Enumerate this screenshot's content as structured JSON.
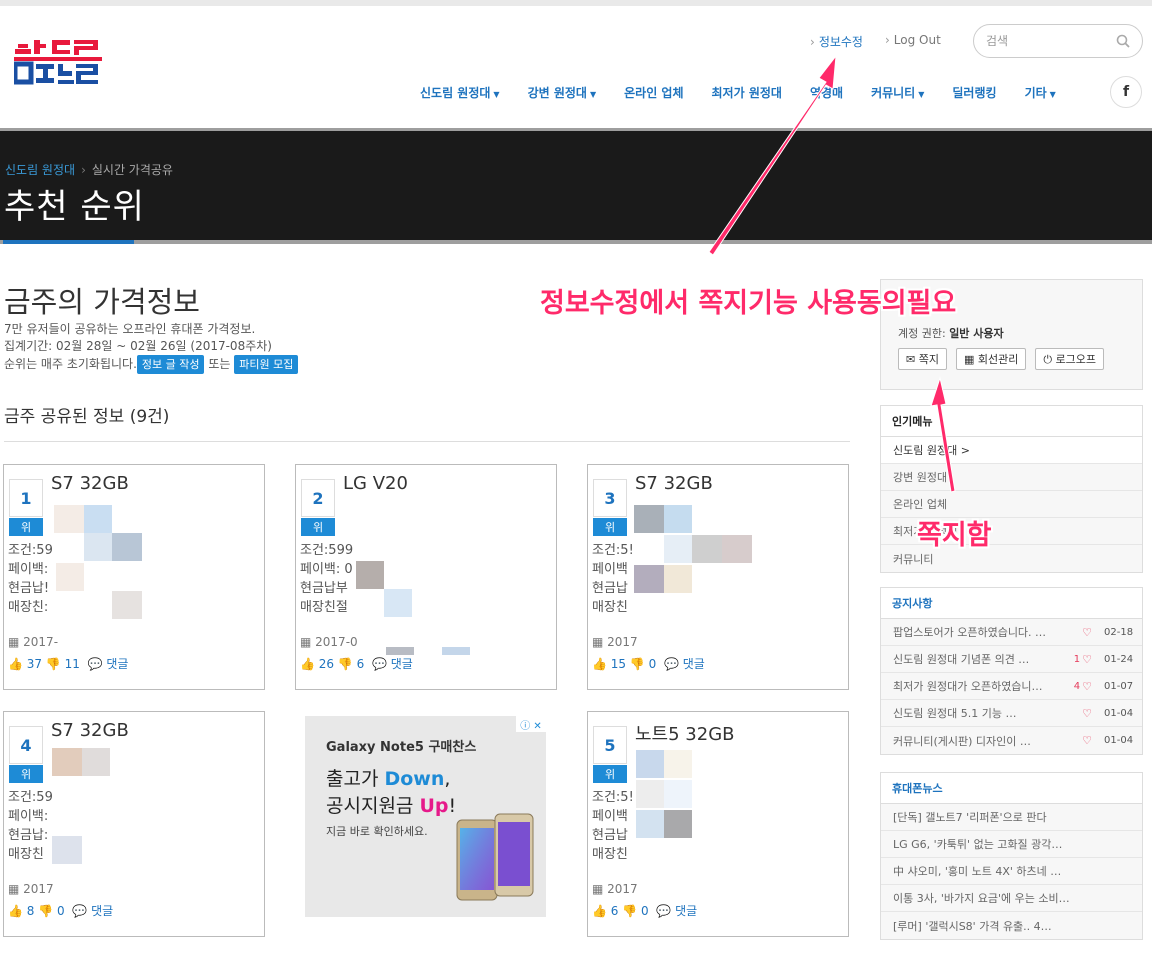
{
  "header": {
    "logo_text": "송도르",
    "toplinks": {
      "edit_info": "정보수정",
      "logout": "Log Out"
    },
    "search": {
      "placeholder": "검색"
    },
    "nav": [
      "신도림 원정대",
      "강변 원정대",
      "온라인 업체",
      "최저가 원정대",
      "역경매",
      "커뮤니티",
      "딜러랭킹",
      "기타"
    ],
    "nav_caret": [
      true,
      true,
      false,
      false,
      false,
      true,
      false,
      true
    ],
    "facebook": "f"
  },
  "banner": {
    "breadcrumb_home": "신도림 원정대",
    "breadcrumb_current": "실시간 가격공유",
    "title": "추천 순위"
  },
  "main": {
    "title": "금주의 가격정보",
    "intro1": "7만 유저들이 공유하는 오프라인 휴대폰 가격정보.",
    "intro2": "집계기간: 02월 28일 ~ 02월 26일 (2017-08주차)",
    "intro3_pre": "순위는 매주 초기화됩니다.",
    "btn_write": "정보 글 작성",
    "intro3_mid": "또는",
    "btn_party": "파티원 모집",
    "shared_title": "금주 공유된 정보 (9건)"
  },
  "cards": [
    {
      "rank": "1",
      "rank_tag": "위",
      "model": "S7 32GB",
      "l1": "조건:59",
      "l2": "페이백:",
      "l3": "현금납!",
      "l4": "매장친:",
      "date": "2017-",
      "likes": "37",
      "dislikes": "11",
      "comments": "댓글"
    },
    {
      "rank": "2",
      "rank_tag": "위",
      "model": "LG V20",
      "l1": "조건:599",
      "l2": "페이백: 0",
      "l3": "현금납부",
      "l4": "매장친절",
      "date": "2017-0",
      "likes": "26",
      "dislikes": "6",
      "comments": "댓글"
    },
    {
      "rank": "3",
      "rank_tag": "위",
      "model": "S7 32GB",
      "l1": "조건:5!",
      "l2": "페이백",
      "l3": "현금납",
      "l4": "매장친",
      "date": "2017",
      "likes": "15",
      "dislikes": "0",
      "comments": "댓글"
    },
    {
      "rank": "4",
      "rank_tag": "위",
      "model": "S7 32GB",
      "l1": "조건:59",
      "l2": "페이백:",
      "l3": "현금납:",
      "l4": "매장친",
      "date": "2017",
      "likes": "8",
      "dislikes": "0",
      "comments": "댓글"
    },
    {
      "rank": "5",
      "rank_tag": "위",
      "model": "노트5 32GB",
      "l1": "조건:5!",
      "l2": "페이백",
      "l3": "현금납",
      "l4": "매장친",
      "date": "2017",
      "likes": "6",
      "dislikes": "0",
      "comments": "댓글"
    }
  ],
  "ad": {
    "brand": "Galaxy Note5 구매찬스",
    "line1_pre": "출고가 ",
    "line1_hl": "Down",
    "line1_post": ",",
    "line2_pre": "공시지원금 ",
    "line2_hl": "Up",
    "line2_post": "!",
    "sub": "지금 바로 확인하세요."
  },
  "sidebar": {
    "role_label": "계정 권한:",
    "role_value": "일반 사용자",
    "btn_note": "쪽지",
    "btn_members": "회선관리",
    "btn_logout": "로그오프",
    "popular_title": "인기메뉴",
    "popular": [
      "신도림 원정대 >",
      "강변 원정대",
      "온라인 업체",
      "최저가 원정대",
      "커뮤니티"
    ],
    "notice_title": "공지사항",
    "notices": [
      {
        "title": "팝업스토어가 오픈하였습니다. …",
        "n": "",
        "date": "02-18"
      },
      {
        "title": "신도림 원정대 기념폰 의견 …",
        "n": "1",
        "date": "01-24"
      },
      {
        "title": "최저가 원정대가 오픈하였습니…",
        "n": "4",
        "date": "01-07"
      },
      {
        "title": "신도림 원정대 5.1 기능 …",
        "n": "",
        "date": "01-04"
      },
      {
        "title": "커뮤니티(게시판) 디자인이 …",
        "n": "",
        "date": "01-04"
      }
    ],
    "news_title": "휴대폰뉴스",
    "news": [
      "[단독] 갤노트7 '리퍼폰'으로 판다",
      "LG G6, '카툭튀' 없는 고화질 광각…",
      "中 샤오미, '홍미 노트 4X' 하츠네 …",
      "이통 3사, '바가지 요금'에 우는 소비…",
      "[루머] '갤럭시S8' 가격 유출.. 4…"
    ]
  },
  "annotations": {
    "main": "정보수정에서 쪽지기능 사용동의필요",
    "note": "쪽지함"
  },
  "colors": {
    "accent": "#1e73be",
    "button": "#1e8bd6",
    "annotation": "#ff2a6a",
    "logo_red": "#e8193c",
    "logo_blue": "#1a4fa3"
  }
}
